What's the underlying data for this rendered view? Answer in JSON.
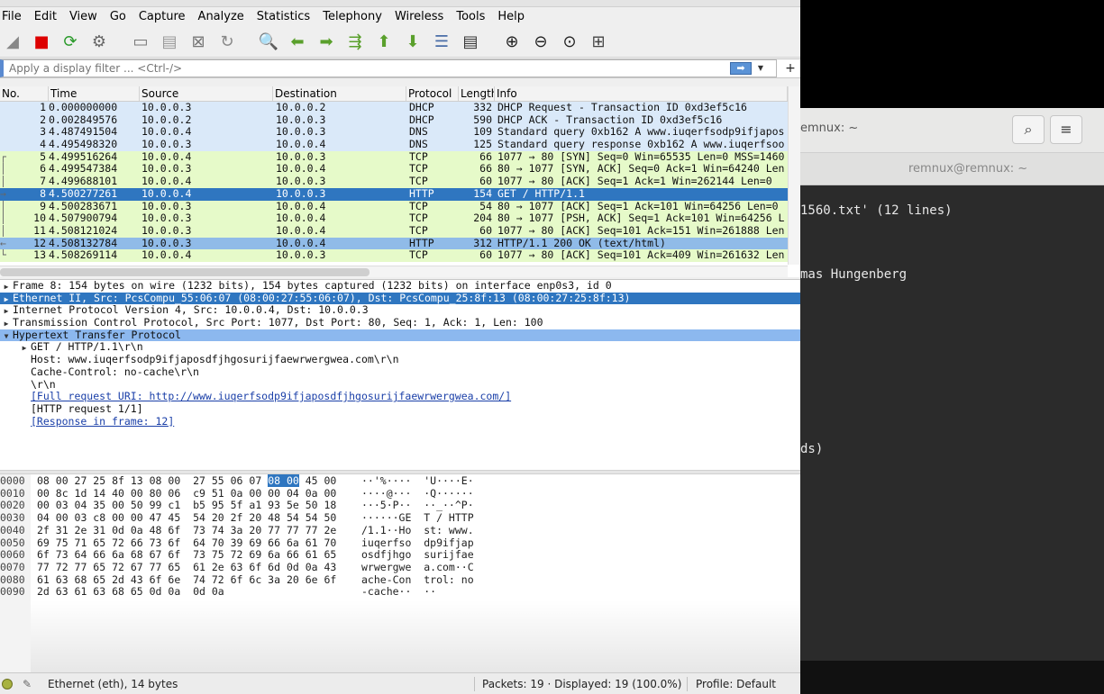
{
  "menubar": {
    "items": [
      "File",
      "Edit",
      "View",
      "Go",
      "Capture",
      "Analyze",
      "Statistics",
      "Telephony",
      "Wireless",
      "Tools",
      "Help"
    ]
  },
  "toolbar": {
    "icons": [
      "shark-fin-start-icon",
      "stop-capture-icon",
      "restart-capture-icon",
      "capture-options-icon",
      "open-file-icon",
      "save-file-icon",
      "close-file-icon",
      "reload-file-icon",
      "find-packet-icon",
      "go-back-icon",
      "go-forward-icon",
      "go-to-packet-icon",
      "go-first-icon",
      "go-last-icon",
      "autoscroll-icon",
      "colorize-icon",
      "zoom-in-icon",
      "zoom-out-icon",
      "zoom-normal-icon",
      "resize-columns-icon"
    ]
  },
  "filter": {
    "placeholder": "Apply a display filter ... <Ctrl-/>",
    "plus": "+"
  },
  "packet_list": {
    "columns": [
      "No.",
      "Time",
      "Source",
      "Destination",
      "Protocol",
      "Length",
      "Info"
    ],
    "rows": [
      {
        "no": "1",
        "time": "0.000000000",
        "src": "10.0.0.3",
        "dst": "10.0.0.2",
        "proto": "DHCP",
        "len": "332",
        "info": "DHCP Request  - Transaction ID 0xd3ef5c16",
        "color": "blue",
        "mark": ""
      },
      {
        "no": "2",
        "time": "0.002849576",
        "src": "10.0.0.2",
        "dst": "10.0.0.3",
        "proto": "DHCP",
        "len": "590",
        "info": "DHCP ACK      - Transaction ID 0xd3ef5c16",
        "color": "blue",
        "mark": ""
      },
      {
        "no": "3",
        "time": "4.487491504",
        "src": "10.0.0.4",
        "dst": "10.0.0.3",
        "proto": "DNS",
        "len": "109",
        "info": "Standard query 0xb162 A www.iuqerfsodp9ifjapos",
        "color": "blue",
        "mark": ""
      },
      {
        "no": "4",
        "time": "4.495498320",
        "src": "10.0.0.3",
        "dst": "10.0.0.4",
        "proto": "DNS",
        "len": "125",
        "info": "Standard query response 0xb162 A www.iuqerfsoo",
        "color": "blue",
        "mark": ""
      },
      {
        "no": "5",
        "time": "4.499516264",
        "src": "10.0.0.4",
        "dst": "10.0.0.3",
        "proto": "TCP",
        "len": "66",
        "info": "1077 → 80 [SYN] Seq=0 Win=65535 Len=0 MSS=1460",
        "color": "green",
        "mark": "┌"
      },
      {
        "no": "6",
        "time": "4.499547384",
        "src": "10.0.0.3",
        "dst": "10.0.0.4",
        "proto": "TCP",
        "len": "66",
        "info": "80 → 1077 [SYN, ACK] Seq=0 Ack=1 Win=64240 Len",
        "color": "green",
        "mark": "│"
      },
      {
        "no": "7",
        "time": "4.499688101",
        "src": "10.0.0.4",
        "dst": "10.0.0.3",
        "proto": "TCP",
        "len": "60",
        "info": "1077 → 80 [ACK] Seq=1 Ack=1 Win=262144 Len=0",
        "color": "green",
        "mark": "│"
      },
      {
        "no": "8",
        "time": "4.500277261",
        "src": "10.0.0.4",
        "dst": "10.0.0.3",
        "proto": "HTTP",
        "len": "154",
        "info": "GET / HTTP/1.1",
        "color": "sel",
        "mark": "→"
      },
      {
        "no": "9",
        "time": "4.500283671",
        "src": "10.0.0.3",
        "dst": "10.0.0.4",
        "proto": "TCP",
        "len": "54",
        "info": "80 → 1077 [ACK] Seq=1 Ack=101 Win=64256 Len=0",
        "color": "green",
        "mark": "│"
      },
      {
        "no": "10",
        "time": "4.507900794",
        "src": "10.0.0.3",
        "dst": "10.0.0.4",
        "proto": "TCP",
        "len": "204",
        "info": "80 → 1077 [PSH, ACK] Seq=1 Ack=101 Win=64256 L",
        "color": "green",
        "mark": "│"
      },
      {
        "no": "11",
        "time": "4.508121024",
        "src": "10.0.0.3",
        "dst": "10.0.0.4",
        "proto": "TCP",
        "len": "60",
        "info": "1077 → 80 [ACK] Seq=101 Ack=151 Win=261888 Len",
        "color": "green",
        "mark": "│"
      },
      {
        "no": "12",
        "time": "4.508132784",
        "src": "10.0.0.3",
        "dst": "10.0.0.4",
        "proto": "HTTP",
        "len": "312",
        "info": "HTTP/1.1 200 OK  (text/html)",
        "color": "http",
        "mark": "←"
      },
      {
        "no": "13",
        "time": "4.508269114",
        "src": "10.0.0.4",
        "dst": "10.0.0.3",
        "proto": "TCP",
        "len": "60",
        "info": "1077 → 80 [ACK] Seq=101 Ack=409 Win=261632 Len",
        "color": "green",
        "mark": "└"
      }
    ]
  },
  "details": {
    "rows": [
      {
        "text": "Frame 8: 154 bytes on wire (1232 bits), 154 bytes captured (1232 bits) on interface enp0s3, id 0",
        "arrow": "▶",
        "style": "",
        "indent": 0
      },
      {
        "text": "Ethernet II, Src: PcsCompu_55:06:07 (08:00:27:55:06:07), Dst: PcsCompu_25:8f:13 (08:00:27:25:8f:13)",
        "arrow": "▶",
        "style": "sel",
        "indent": 0
      },
      {
        "text": "Internet Protocol Version 4, Src: 10.0.0.4, Dst: 10.0.0.3",
        "arrow": "▶",
        "style": "",
        "indent": 0
      },
      {
        "text": "Transmission Control Protocol, Src Port: 1077, Dst Port: 80, Seq: 1, Ack: 1, Len: 100",
        "arrow": "▶",
        "style": "",
        "indent": 0
      },
      {
        "text": "Hypertext Transfer Protocol",
        "arrow": "▼",
        "style": "hl",
        "indent": 0
      },
      {
        "text": "GET / HTTP/1.1\\r\\n",
        "arrow": "▶",
        "style": "",
        "indent": 1
      },
      {
        "text": "Host: www.iuqerfsodp9ifjaposdfjhgosurijfaewrwergwea.com\\r\\n",
        "arrow": "",
        "style": "",
        "indent": 2
      },
      {
        "text": "Cache-Control: no-cache\\r\\n",
        "arrow": "",
        "style": "",
        "indent": 2
      },
      {
        "text": "\\r\\n",
        "arrow": "",
        "style": "",
        "indent": 2
      },
      {
        "text": "[Full request URI: http://www.iuqerfsodp9ifjaposdfjhgosurijfaewrwergwea.com/]",
        "arrow": "",
        "style": "link",
        "indent": 2
      },
      {
        "text": "[HTTP request 1/1]",
        "arrow": "",
        "style": "",
        "indent": 2
      },
      {
        "text": "[Response in frame: 12]",
        "arrow": "",
        "style": "link",
        "indent": 2
      }
    ]
  },
  "bytes": {
    "rows": [
      {
        "off": "0000",
        "hexA": "08 00 27 25 8f 13 08 00  27 55 06 07 ",
        "hexSel": "08 00",
        "hexB": " 45 00",
        "ascii": "··'%····  'U····E·"
      },
      {
        "off": "0010",
        "hexA": "00 8c 1d 14 40 00 80 06  c9 51 0a 00 00 04 0a 00",
        "hexSel": "",
        "hexB": "",
        "ascii": "····@···  ·Q······"
      },
      {
        "off": "0020",
        "hexA": "00 03 04 35 00 50 99 c1  b5 95 5f a1 93 5e 50 18",
        "hexSel": "",
        "hexB": "",
        "ascii": "···5·P··  ··_··^P·"
      },
      {
        "off": "0030",
        "hexA": "04 00 03 c8 00 00 47 45  54 20 2f 20 48 54 54 50",
        "hexSel": "",
        "hexB": "",
        "ascii": "······GE  T / HTTP"
      },
      {
        "off": "0040",
        "hexA": "2f 31 2e 31 0d 0a 48 6f  73 74 3a 20 77 77 77 2e",
        "hexSel": "",
        "hexB": "",
        "ascii": "/1.1··Ho  st: www."
      },
      {
        "off": "0050",
        "hexA": "69 75 71 65 72 66 73 6f  64 70 39 69 66 6a 61 70",
        "hexSel": "",
        "hexB": "",
        "ascii": "iuqerfso  dp9ifjap"
      },
      {
        "off": "0060",
        "hexA": "6f 73 64 66 6a 68 67 6f  73 75 72 69 6a 66 61 65",
        "hexSel": "",
        "hexB": "",
        "ascii": "osdfjhgo  surijfae"
      },
      {
        "off": "0070",
        "hexA": "77 72 77 65 72 67 77 65  61 2e 63 6f 6d 0d 0a 43",
        "hexSel": "",
        "hexB": "",
        "ascii": "wrwergwe  a.com··C"
      },
      {
        "off": "0080",
        "hexA": "61 63 68 65 2d 43 6f 6e  74 72 6f 6c 3a 20 6e 6f",
        "hexSel": "",
        "hexB": "",
        "ascii": "ache-Con  trol: no"
      },
      {
        "off": "0090",
        "hexA": "2d 63 61 63 68 65 0d 0a  0d 0a",
        "hexSel": "",
        "hexB": "",
        "ascii": "-cache··  ··"
      }
    ]
  },
  "statusbar": {
    "interface": "Ethernet (eth), 14 bytes",
    "packets": "Packets: 19 · Displayed: 19 (100.0%)",
    "profile": "Profile: Default"
  },
  "terminal": {
    "tab_title": "emnux: ~",
    "window_title": "remnux@remnux: ~",
    "lines": [
      "1560.txt' (12 lines)",
      "mas Hungenberg",
      "ds)"
    ]
  }
}
